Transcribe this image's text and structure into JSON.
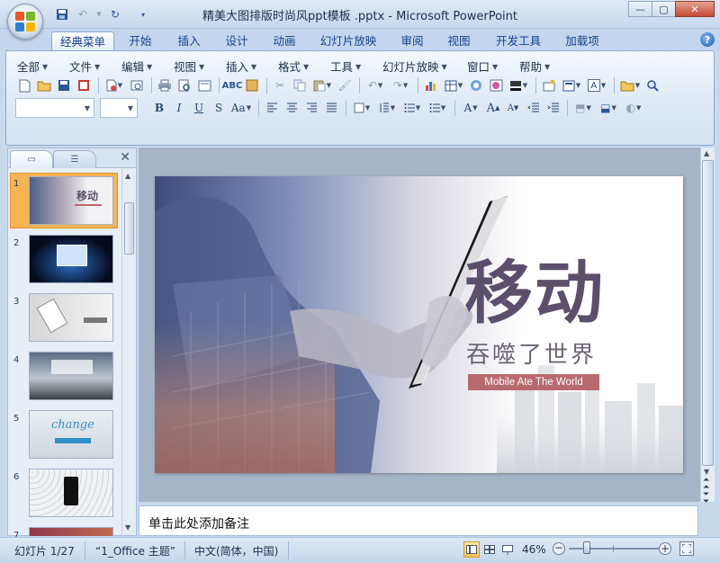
{
  "window": {
    "title": "精美大图排版时尚风ppt模板 .pptx - Microsoft PowerPoint",
    "controls": [
      "—",
      "▢",
      "✕"
    ]
  },
  "ribbon_tabs": [
    {
      "label": "经典菜单",
      "active": true
    },
    {
      "label": "开始"
    },
    {
      "label": "插入"
    },
    {
      "label": "设计"
    },
    {
      "label": "动画"
    },
    {
      "label": "幻灯片放映"
    },
    {
      "label": "审阅"
    },
    {
      "label": "视图"
    },
    {
      "label": "开发工具"
    },
    {
      "label": "加载项"
    }
  ],
  "menu": [
    "全部",
    "文件",
    "编辑",
    "视图",
    "插入",
    "格式",
    "工具",
    "幻灯片放映",
    "窗口",
    "帮助"
  ],
  "format_buttons": {
    "bold": "B",
    "italic": "I",
    "underline": "U",
    "strike": "S",
    "case": "Aa",
    "font_a": "A"
  },
  "panel": {
    "slides": [
      {
        "number": "1",
        "selected": true
      },
      {
        "number": "2"
      },
      {
        "number": "3"
      },
      {
        "number": "4"
      },
      {
        "number": "5"
      },
      {
        "number": "6"
      },
      {
        "number": "7"
      }
    ]
  },
  "thumb_text": {
    "t1": "移动",
    "t5": "change"
  },
  "slide": {
    "headline": "移动",
    "subtitle": "吞噬了世界",
    "tagline": "Mobile Ate The World",
    "colors": {
      "headline": "#5b4f6b",
      "subtitle": "#6d6476",
      "tag_bg": "#b86a6e",
      "tag_text": "#ffffff"
    }
  },
  "notes": {
    "placeholder": "单击此处添加备注"
  },
  "status": {
    "slide_counter": "幻灯片 1/27",
    "theme": "“1_Office 主题”",
    "language": "中文(简体，中国)",
    "zoom": "46%",
    "zoom_value": 46
  }
}
